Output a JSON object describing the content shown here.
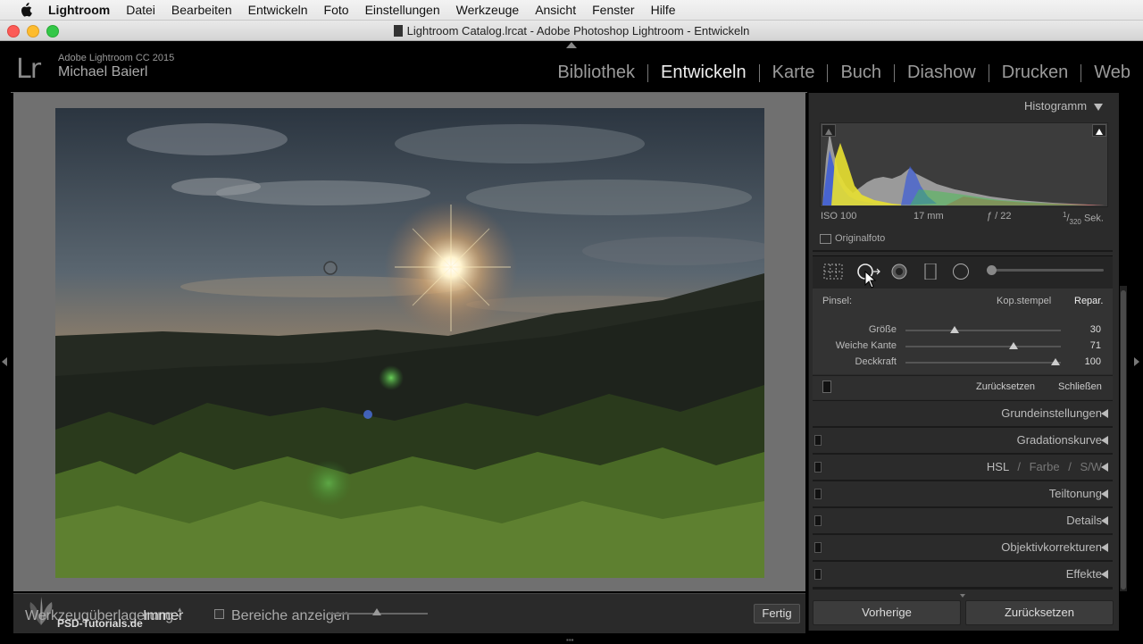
{
  "menubar": {
    "apple_icon": "apple-icon",
    "items": [
      "Lightroom",
      "Datei",
      "Bearbeiten",
      "Entwickeln",
      "Foto",
      "Einstellungen",
      "Werkzeuge",
      "Ansicht",
      "Fenster",
      "Hilfe"
    ]
  },
  "window": {
    "title": "Lightroom Catalog.lrcat - Adobe Photoshop Lightroom - Entwickeln"
  },
  "identity": {
    "logo_text": "Lr",
    "product": "Adobe Lightroom CC 2015",
    "user": "Michael Baierl"
  },
  "modules": {
    "items": [
      "Bibliothek",
      "Entwickeln",
      "Karte",
      "Buch",
      "Diashow",
      "Drucken",
      "Web"
    ],
    "active": "Entwickeln"
  },
  "toolbar": {
    "overlay_label": "Werkzeugüberlagerung:",
    "overlay_value": "Immer",
    "show_areas_label": "Bereiche anzeigen",
    "show_areas_checked": false,
    "done_label": "Fertig",
    "brand": "PSD-Tutorials.de"
  },
  "histogram": {
    "title": "Histogramm",
    "iso": "ISO 100",
    "focal": "17 mm",
    "aperture": "ƒ / 22",
    "shutter_num": "1",
    "shutter_den": "320",
    "shutter_unit": "Sek.",
    "original_label": "Originalfoto",
    "colors": {
      "blue": "#3a5bd8",
      "yellow": "#e8e030",
      "green": "#3fc74a",
      "red": "#d03a3a",
      "gray": "#9a9a9a"
    }
  },
  "tools": {
    "icons": [
      "crop-grid-icon",
      "spot-removal-icon",
      "red-eye-icon",
      "graduated-filter-icon",
      "radial-filter-icon"
    ],
    "strip_slider_value": 0
  },
  "spot": {
    "brush_label": "Pinsel:",
    "mode_clone": "Kop.stempel",
    "mode_heal": "Repar.",
    "sliders": [
      {
        "label": "Größe",
        "value": "30",
        "fraction": 0.3
      },
      {
        "label": "Weiche Kante",
        "value": "71",
        "fraction": 0.71
      },
      {
        "label": "Deckkraft",
        "value": "100",
        "fraction": 1.0
      }
    ],
    "reset_label": "Zurücksetzen",
    "close_label": "Schließen"
  },
  "sections": {
    "basic": "Grundeinstellungen",
    "tone_curve": "Gradationskurve",
    "hsl": "HSL",
    "hsl_sep": "/",
    "color": "Farbe",
    "bw": "S/W",
    "split_toning": "Teiltonung",
    "details": "Details",
    "lens": "Objektivkorrekturen",
    "effects": "Effekte"
  },
  "bottom_buttons": {
    "previous": "Vorherige",
    "reset": "Zurücksetzen"
  }
}
